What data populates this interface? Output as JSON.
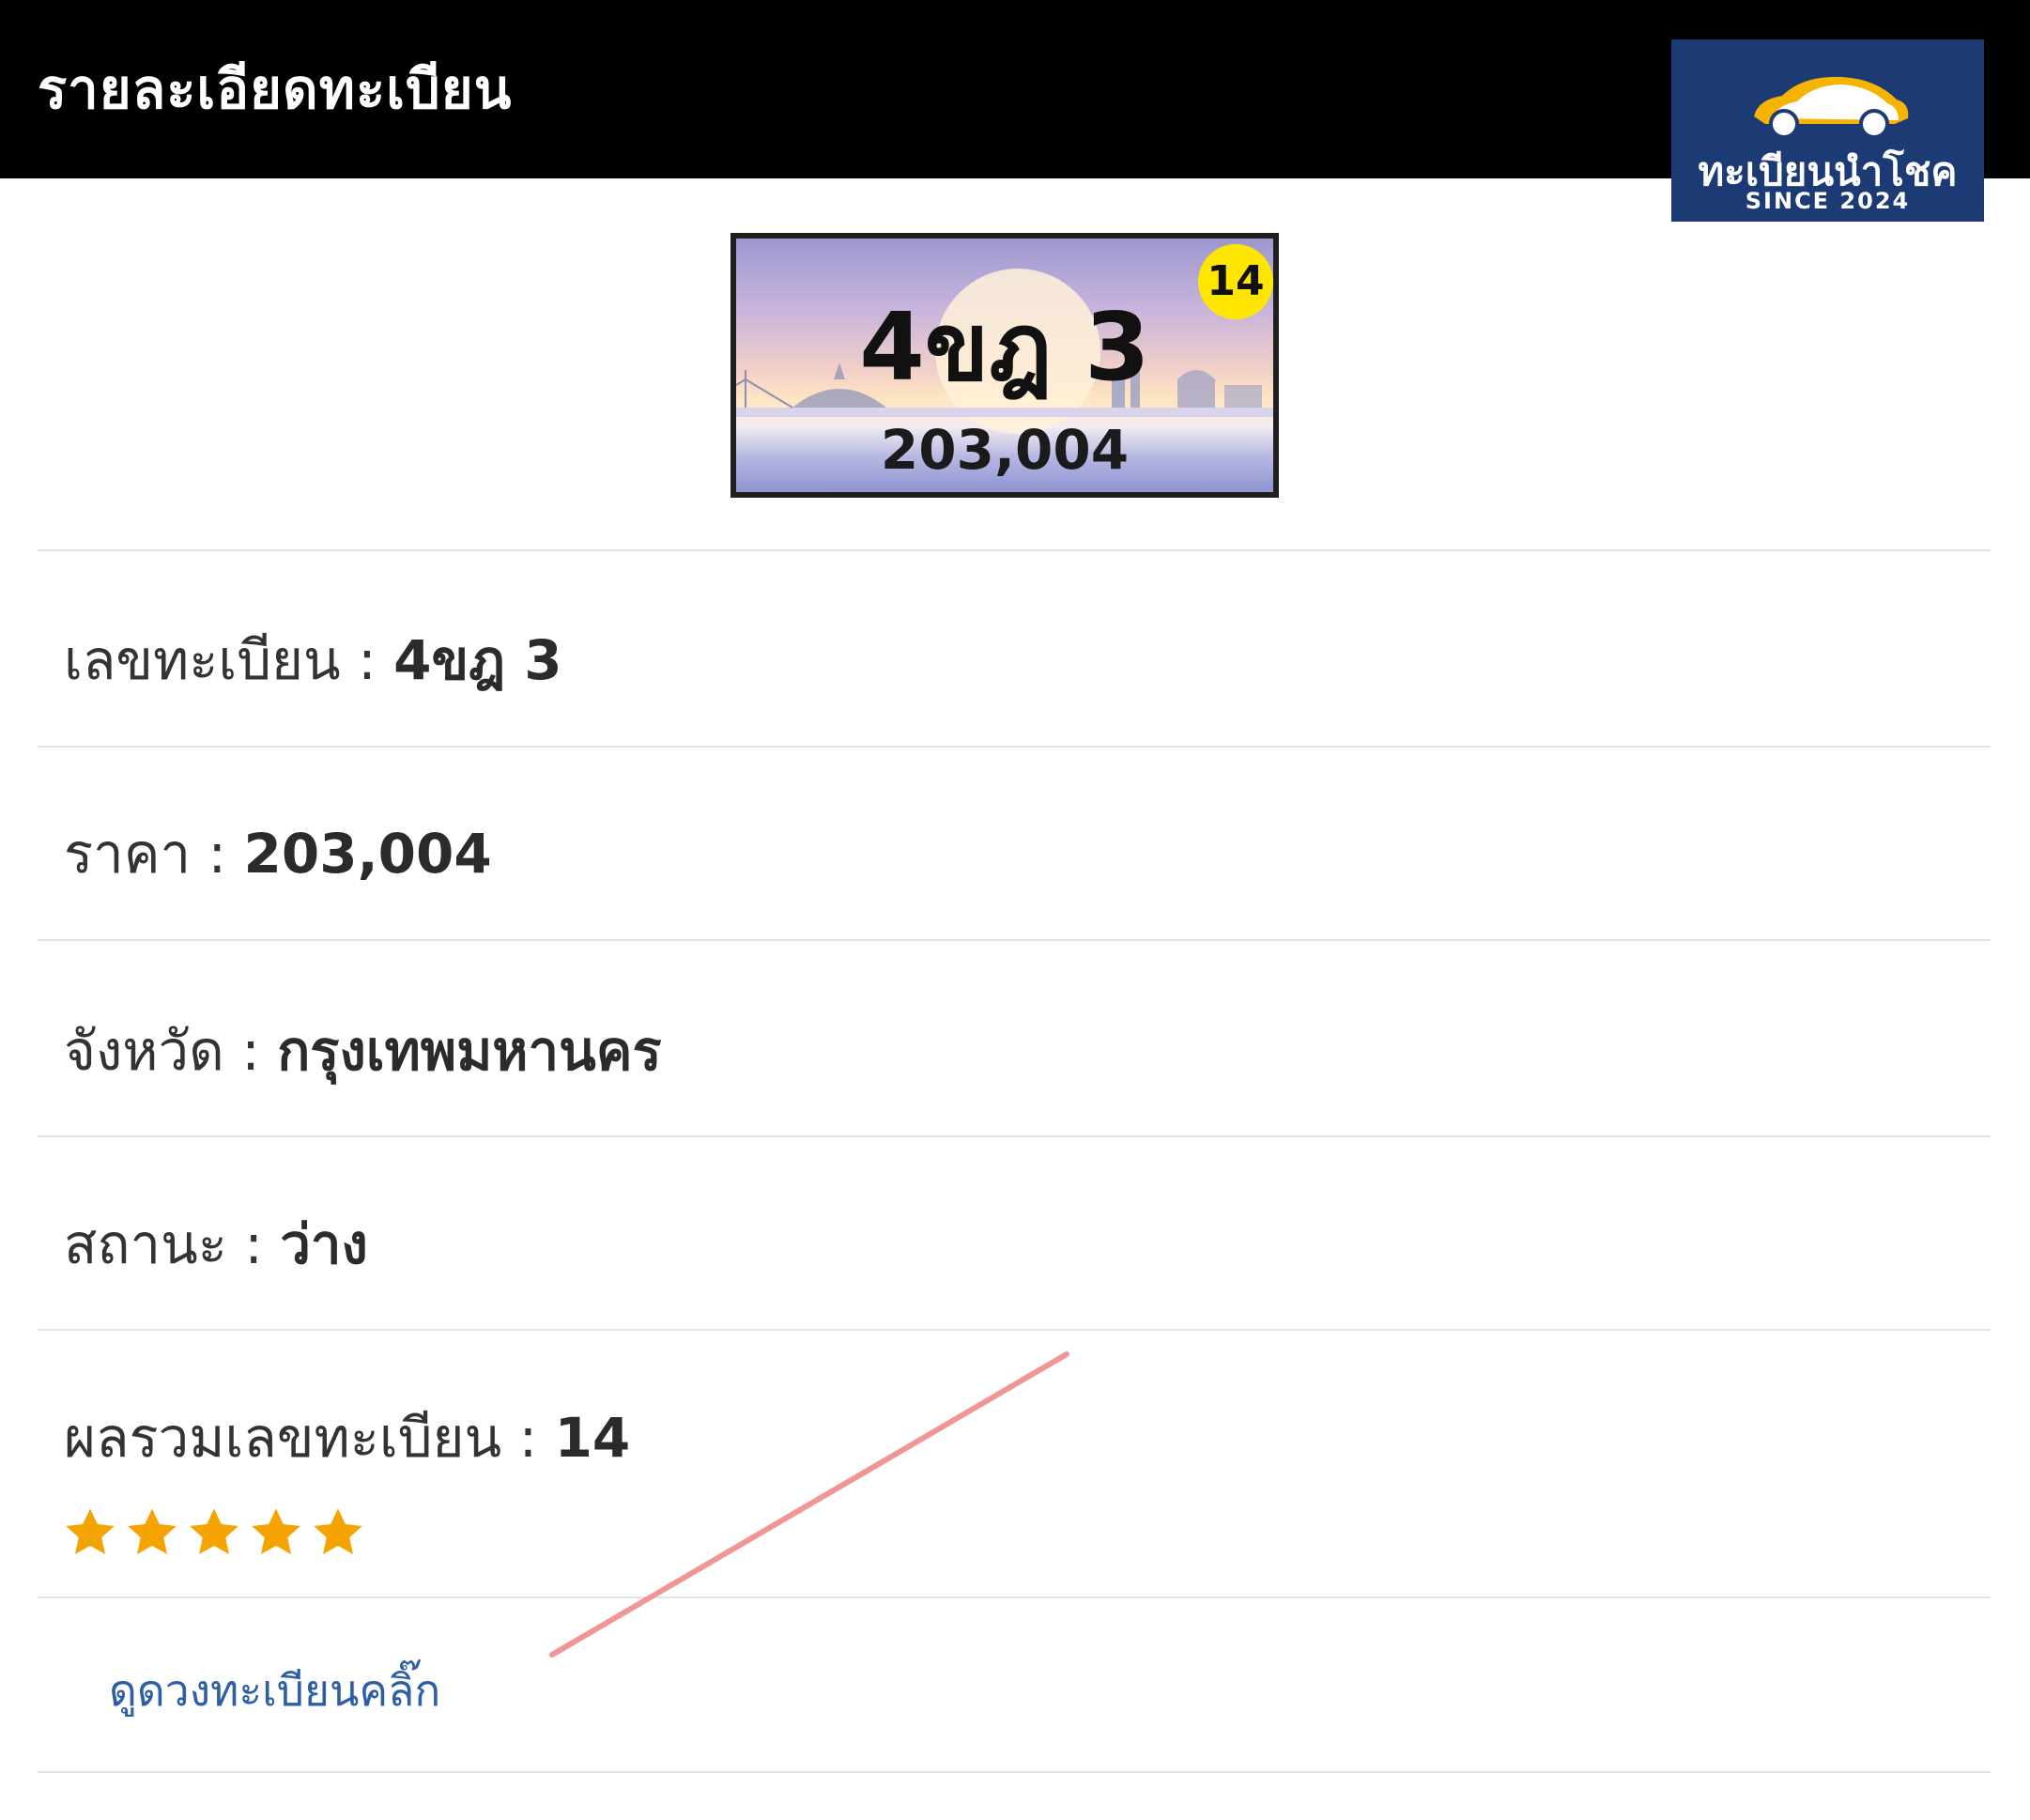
{
  "header": {
    "title": "รายละเอียดทะเบียน"
  },
  "logo": {
    "name": "ทะเบียนนำโชค",
    "since": "SINCE 2024"
  },
  "plate": {
    "number": "4ขฎ 3",
    "price": "203,004",
    "badge": "14",
    "badge_color": "#ffe600"
  },
  "details": [
    {
      "label": "เลขทะเบียน : ",
      "value": "4ขฎ 3"
    },
    {
      "label": "ราคา : ",
      "value": "203,004"
    },
    {
      "label": "จังหวัด : ",
      "value": "กรุงเทพมหานคร"
    },
    {
      "label": "สถานะ : ",
      "value": "ว่าง"
    },
    {
      "label": "ผลรวมเลขทะเบียน : ",
      "value": "14"
    }
  ],
  "rating": {
    "stars": 5,
    "max": 5,
    "color": "#f5a300"
  },
  "horoscope_link": "ดูดวงทะเบียนคลิ๊ก"
}
